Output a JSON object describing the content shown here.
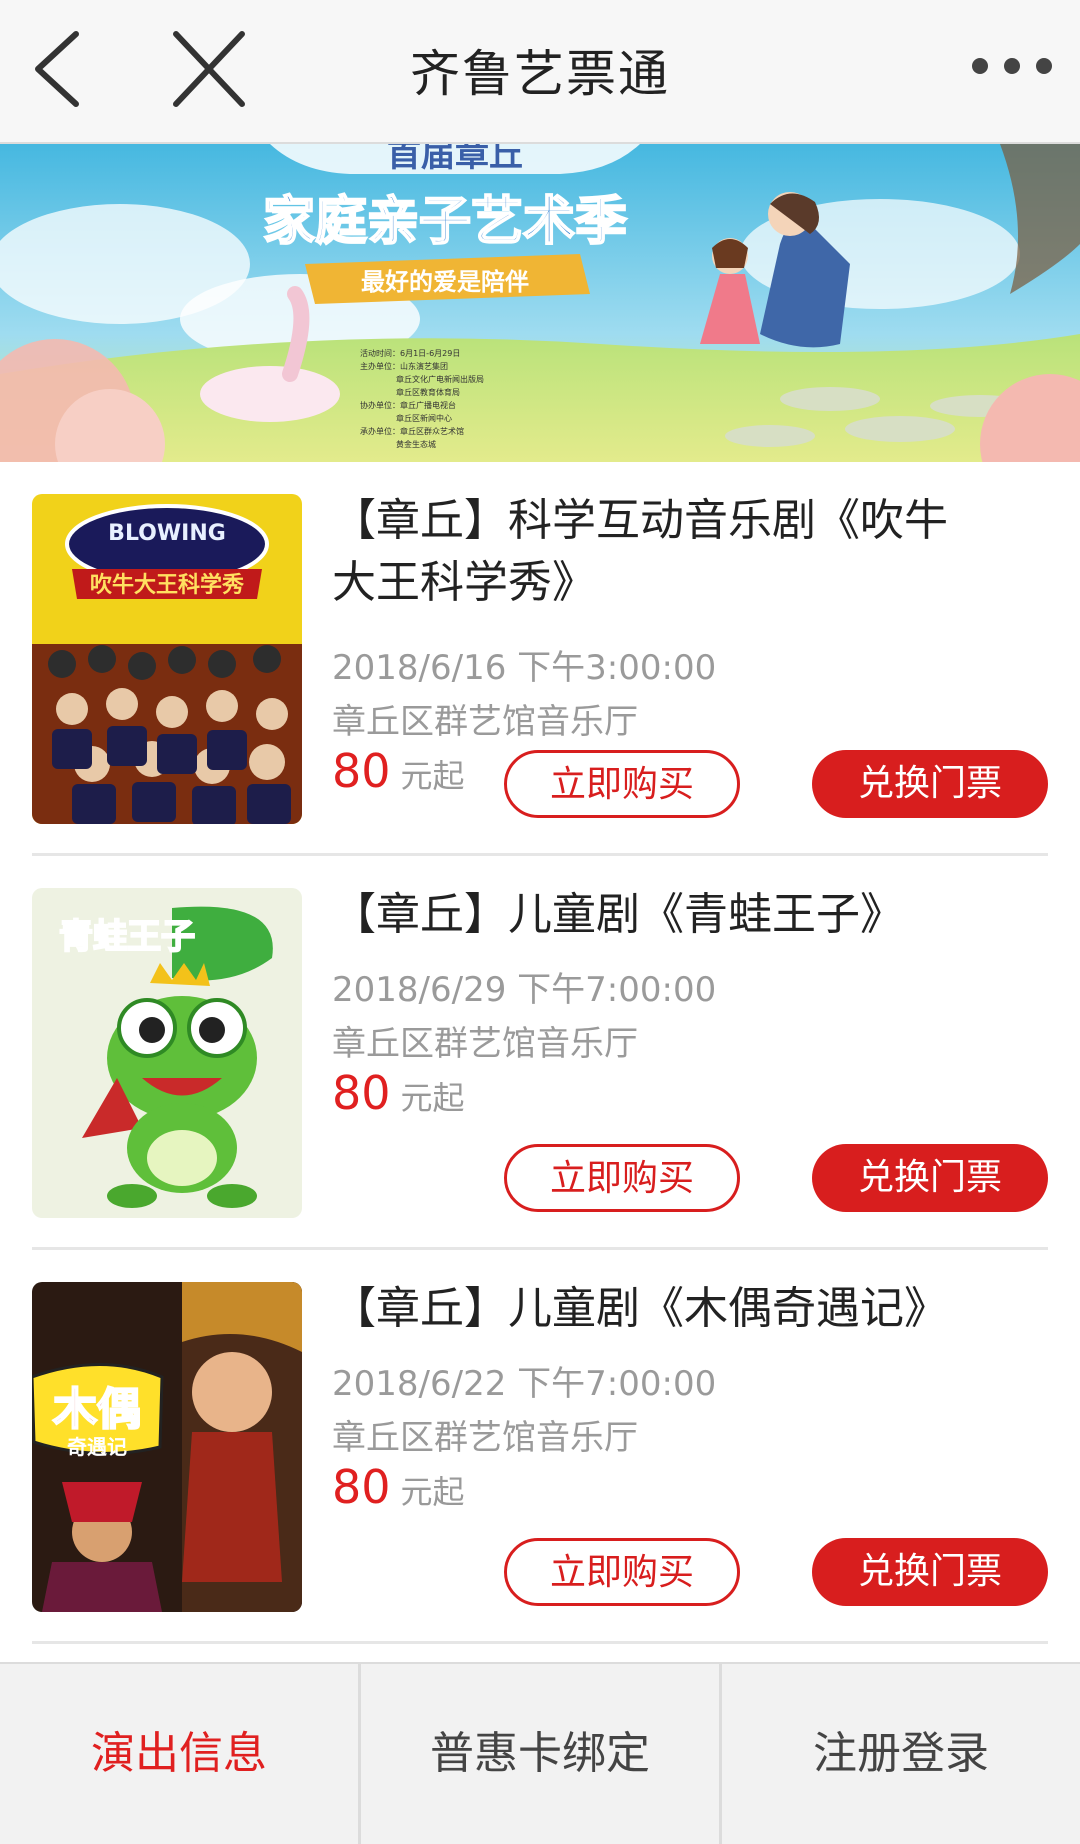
{
  "header": {
    "title": "齐鲁艺票通"
  },
  "banner": {
    "line1": "首届章丘",
    "headline": "家庭亲子艺术季",
    "ribbon": "最好的爱是陪伴",
    "details": [
      "活动时间：6月1日-6月29日",
      "主办单位：山东演艺集团",
      "章丘文化广电新闻出版局",
      "章丘区教育体育局",
      "协办单位：章丘广播电视台",
      "章丘区新闻中心",
      "承办单位：章丘区群众艺术馆",
      "黄金生态城"
    ]
  },
  "shows": [
    {
      "title": "【章丘】科学互动音乐剧《吹牛大王科学秀》",
      "title_line1": "【章丘】科学互动音乐剧《吹牛",
      "title_line2": "大王科学秀》",
      "datetime": "2018/6/16 下午3:00:00",
      "venue": "章丘区群艺馆音乐厅",
      "price": "80",
      "price_unit": "元起",
      "buy_label": "立即购买",
      "redeem_label": "兑换门票",
      "poster_text": "吹牛大王科学秀"
    },
    {
      "title": "【章丘】儿童剧《青蛙王子》",
      "datetime": "2018/6/29 下午7:00:00",
      "venue": "章丘区群艺馆音乐厅",
      "price": "80",
      "price_unit": "元起",
      "buy_label": "立即购买",
      "redeem_label": "兑换门票",
      "poster_text": "青蛙王子"
    },
    {
      "title": "【章丘】儿童剧《木偶奇遇记》",
      "datetime": "2018/6/22 下午7:00:00",
      "venue": "章丘区群艺馆音乐厅",
      "price": "80",
      "price_unit": "元起",
      "buy_label": "立即购买",
      "redeem_label": "兑换门票",
      "poster_text_big": "木偶",
      "poster_text_small": "奇遇记"
    }
  ],
  "tabs": [
    {
      "label": "演出信息",
      "active": true
    },
    {
      "label": "普惠卡绑定",
      "active": false
    },
    {
      "label": "注册登录",
      "active": false
    }
  ],
  "colors": {
    "accent": "#d81e1e",
    "price": "#e02020"
  }
}
